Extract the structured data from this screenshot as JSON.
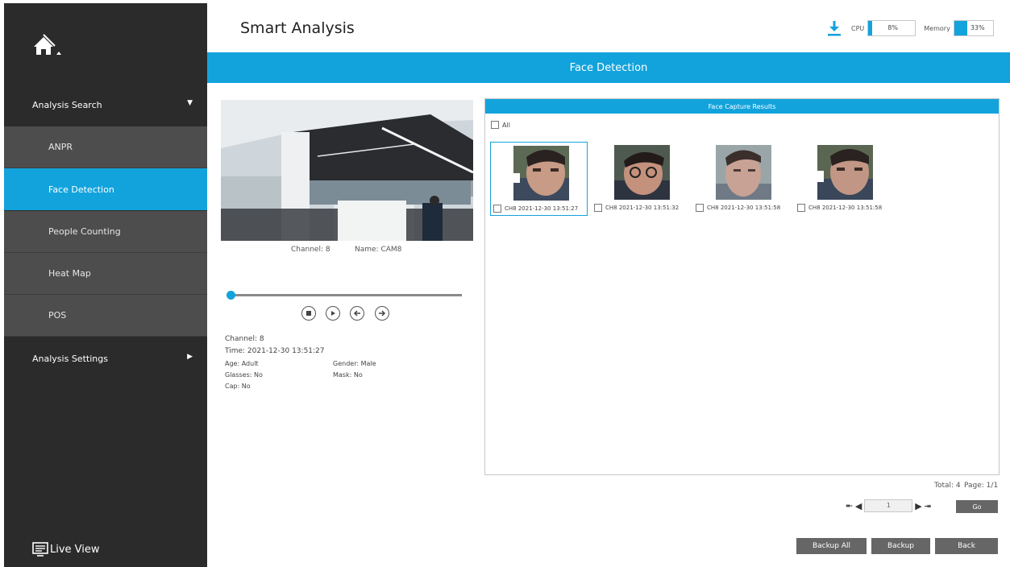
{
  "sidebar": {
    "home_icon": "home-icon",
    "analysis_search": "Analysis Search",
    "items": [
      {
        "label": "ANPR"
      },
      {
        "label": "Face Detection",
        "active": true
      },
      {
        "label": "People Counting"
      },
      {
        "label": "Heat Map"
      },
      {
        "label": "POS"
      }
    ],
    "analysis_settings": "Analysis Settings",
    "live_view": "Live View"
  },
  "header": {
    "title": "Smart Analysis",
    "cpu_label": "CPU",
    "cpu_value": "8%",
    "cpu_fraction": 0.08,
    "memory_label": "Memory",
    "memory_value": "33%",
    "memory_fraction": 0.33
  },
  "banner": "Face Detection",
  "video": {
    "channel": "Channel: 8",
    "name": "Name: CAM8",
    "progress_fraction": 0.0
  },
  "details": {
    "channel": "Channel: 8",
    "time": "Time: 2021-12-30 13:51:27",
    "age": "Age: Adult",
    "gender": "Gender: Male",
    "glasses": "Glasses: No",
    "mask": "Mask: No",
    "cap": "Cap: No"
  },
  "results": {
    "title": "Face Capture Results",
    "all_label": "All",
    "captures": [
      {
        "label": "CH8  2021-12-30 13:51:27",
        "selected": true
      },
      {
        "label": "CH8  2021-12-30 13:51:32"
      },
      {
        "label": "CH8  2021-12-30 13:51:58"
      },
      {
        "label": "CH8  2021-12-30 13:51:58"
      }
    ]
  },
  "pagination": {
    "total": "Total: 4",
    "page": "Page: 1/1",
    "input_value": "1",
    "go": "Go"
  },
  "buttons": {
    "backup_all": "Backup All",
    "backup": "Backup",
    "back": "Back"
  },
  "colors": {
    "accent": "#12a3dc",
    "sidebar": "#2b2b2b",
    "sidebar_item": "#4d4d4d"
  }
}
